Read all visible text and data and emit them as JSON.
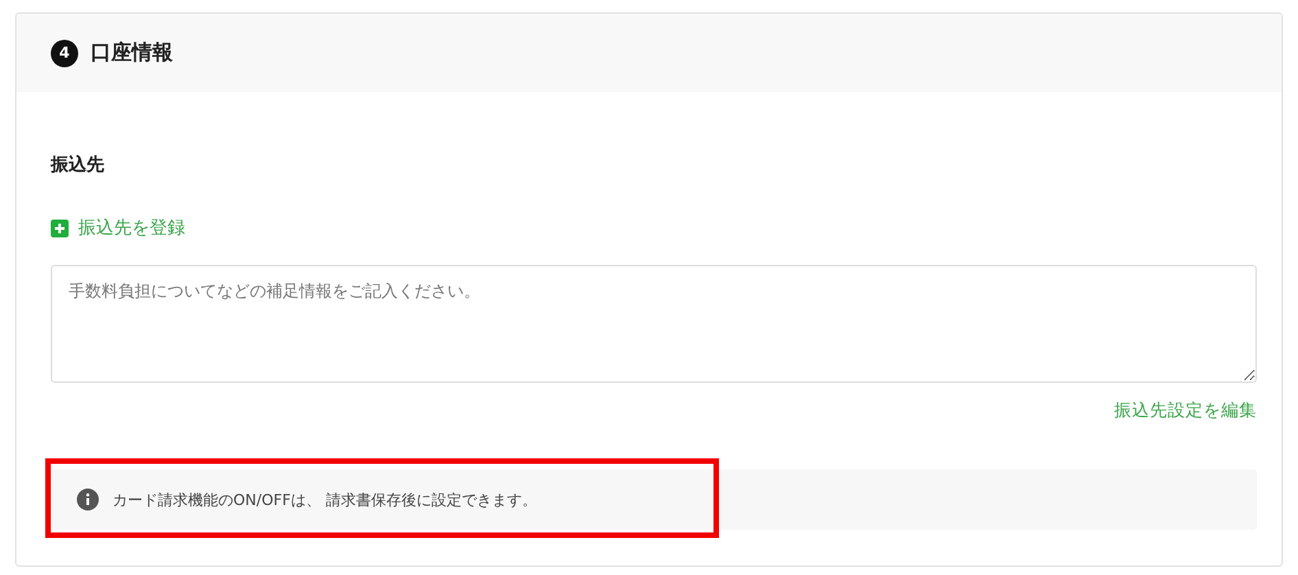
{
  "section": {
    "number": "4",
    "title": "口座情報"
  },
  "recipient": {
    "label": "振込先",
    "add_link": "振込先を登録",
    "note_field": {
      "placeholder": "手数料負担についてなどの補足情報をご記入ください。"
    },
    "edit_link": "振込先設定を編集"
  },
  "notice": {
    "text": "カード請求機能のON/OFFは、 請求書保存後に設定できます。",
    "highlighted": true
  }
}
